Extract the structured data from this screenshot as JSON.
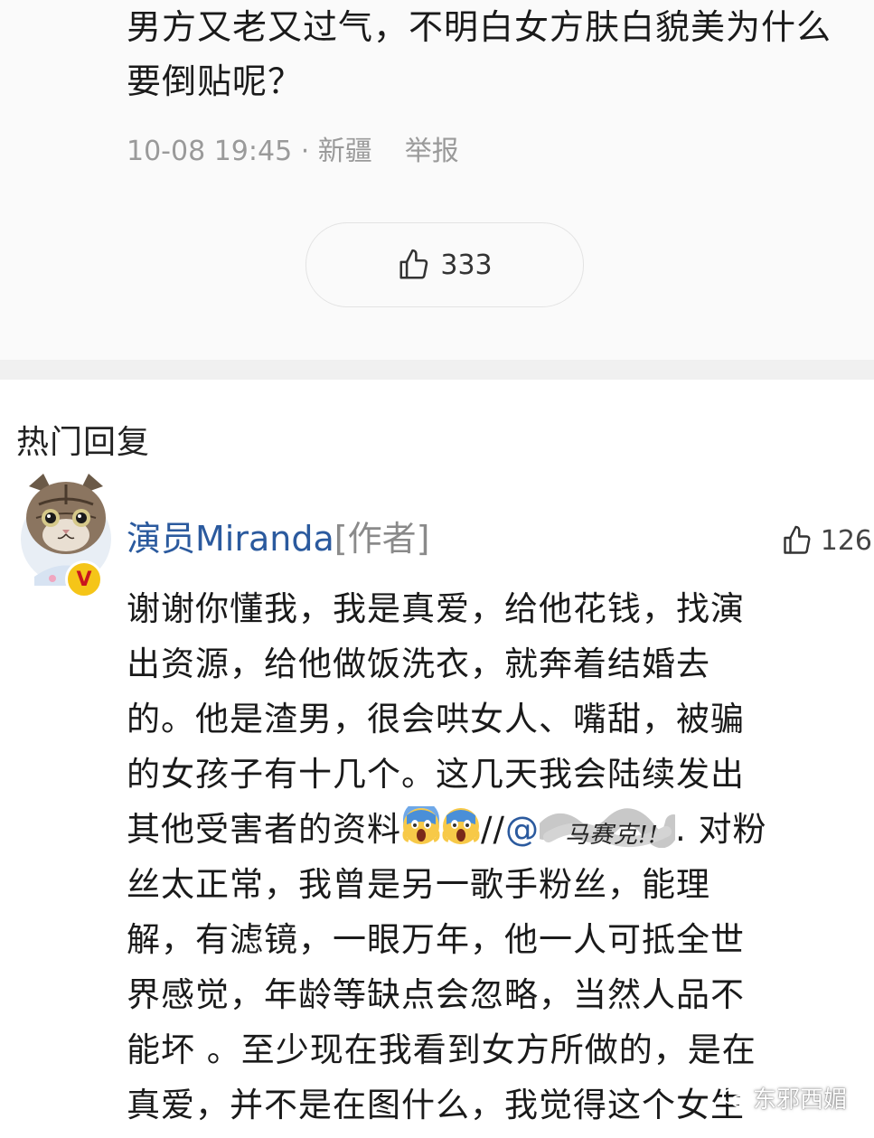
{
  "comment": {
    "text": "男方又老又过气，不明白女方肤白貌美为什么要倒贴呢？",
    "time": "10-08 19:45 · 新疆",
    "report_label": "举报",
    "like_count": "333"
  },
  "hot_replies": {
    "title": "热门回复",
    "reply": {
      "username": "演员Miranda",
      "author_tag": "[作者]",
      "verified_badge": "V",
      "like_count": "126",
      "lines": [
        "谢谢你懂我，我是真爱，给他花钱，找演",
        "出资源，给他做饭洗衣，就奔着结婚去",
        "的。他是渣男，很会哄女人、嘴甜，被骗",
        "的女孩子有十几个。这几天我会陆续发出",
        "其他受害者的资料",
        "//",
        "@",
        "马赛克!!",
        ". 对粉",
        "丝太正常，我曾是另一歌手粉丝，能理",
        "解，有滤镜，一眼万年，他一人可抵全世",
        "界感觉，年龄等缺点会忽略，当然人品不",
        "能坏 。至少现在我看到女方所做的，是在",
        "真爱，并不是在图什么，我觉得这个女生"
      ],
      "emojis": [
        "scream-emoji",
        "scream-emoji"
      ]
    }
  },
  "watermark": {
    "text": "东邪西媚"
  },
  "colors": {
    "link_blue": "#2b5a9e",
    "meta_gray": "#9a9a9a",
    "divider": "#f0f0f0",
    "badge_yellow": "#f5c518"
  }
}
